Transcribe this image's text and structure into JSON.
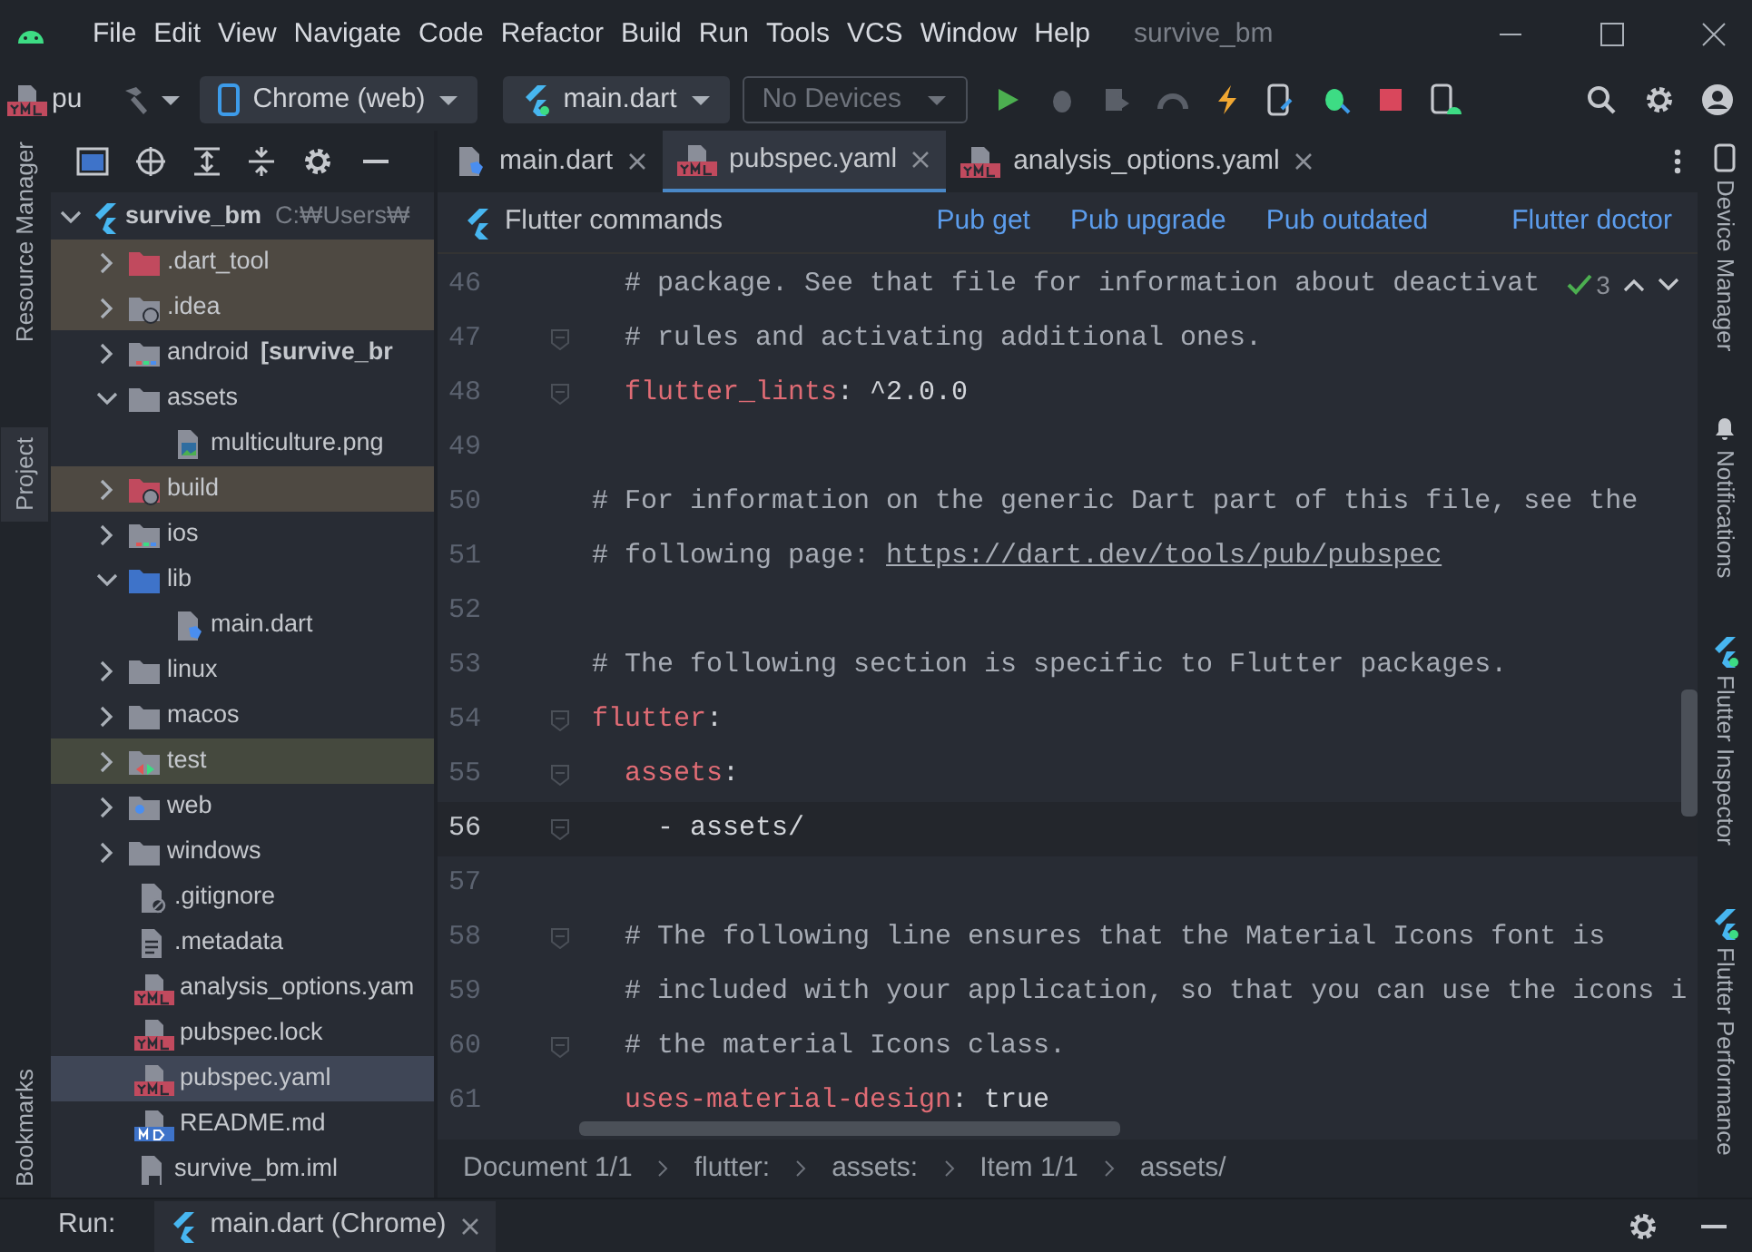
{
  "window": {
    "menu": [
      "File",
      "Edit",
      "View",
      "Navigate",
      "Code",
      "Refactor",
      "Build",
      "Run",
      "Tools",
      "VCS",
      "Window",
      "Help"
    ],
    "title": "survive_bm"
  },
  "toolbar": {
    "project_label": "pu",
    "device": "Chrome (web)",
    "config": "main.dart",
    "devices_placeholder": "No Devices"
  },
  "left_strip": [
    {
      "label": "Resource Manager",
      "selected": false
    },
    {
      "label": "Project",
      "selected": true
    },
    {
      "label": "Bookmarks",
      "selected": false
    }
  ],
  "right_strip": [
    {
      "label": "Device Manager"
    },
    {
      "label": "Notifications"
    },
    {
      "label": "Flutter Inspector"
    },
    {
      "label": "Flutter Performance"
    }
  ],
  "project_tree": [
    {
      "name": "survive_bm",
      "kind": "flutter",
      "path": "C:₩Users₩",
      "expanded": true,
      "selected": false,
      "children": [
        {
          "name": ".dart_tool",
          "kind": "folder-excluded",
          "expanded": false,
          "selected": false,
          "color": "#4e4942"
        },
        {
          "name": ".idea",
          "kind": "folder-settings",
          "expanded": false,
          "selected": false,
          "color": "#4e4942"
        },
        {
          "name": "android",
          "kind": "folder-module",
          "module": "[survive_br",
          "expanded": false,
          "selected": false
        },
        {
          "name": "assets",
          "kind": "folder",
          "expanded": true,
          "selected": false,
          "children": [
            {
              "name": "multiculture.png",
              "kind": "image",
              "selected": false
            }
          ]
        },
        {
          "name": "build",
          "kind": "folder-build",
          "expanded": false,
          "selected": false,
          "color": "#4e4942"
        },
        {
          "name": "ios",
          "kind": "folder-module",
          "expanded": false,
          "selected": false
        },
        {
          "name": "lib",
          "kind": "folder-source",
          "expanded": true,
          "selected": false,
          "children": [
            {
              "name": "main.dart",
              "kind": "dart",
              "selected": false
            }
          ]
        },
        {
          "name": "linux",
          "kind": "folder",
          "expanded": false,
          "selected": false
        },
        {
          "name": "macos",
          "kind": "folder",
          "expanded": false,
          "selected": false
        },
        {
          "name": "test",
          "kind": "folder-test",
          "expanded": false,
          "selected": false,
          "color": "#45493e"
        },
        {
          "name": "web",
          "kind": "folder-web",
          "expanded": false,
          "selected": false
        },
        {
          "name": "windows",
          "kind": "folder",
          "expanded": false,
          "selected": false
        },
        {
          "name": ".gitignore",
          "kind": "ignore",
          "selected": false
        },
        {
          "name": ".metadata",
          "kind": "text",
          "selected": false
        },
        {
          "name": "analysis_options.yam",
          "kind": "yaml",
          "selected": false
        },
        {
          "name": "pubspec.lock",
          "kind": "yaml",
          "selected": false
        },
        {
          "name": "pubspec.yaml",
          "kind": "yaml",
          "selected": true
        },
        {
          "name": "README.md",
          "kind": "markdown",
          "selected": false
        },
        {
          "name": "survive_bm.iml",
          "kind": "iml",
          "selected": false
        }
      ]
    }
  ],
  "tabs": [
    {
      "label": "main.dart",
      "kind": "dart",
      "selected": false
    },
    {
      "label": "pubspec.yaml",
      "kind": "yaml",
      "selected": true
    },
    {
      "label": "analysis_options.yaml",
      "kind": "yaml",
      "selected": false
    }
  ],
  "flutter_commands": {
    "label": "Flutter commands",
    "links": [
      "Pub get",
      "Pub upgrade",
      "Pub outdated",
      "Flutter doctor"
    ]
  },
  "editor": {
    "inspection_count": "3",
    "lines": [
      {
        "number": "46",
        "fold": false,
        "current": false,
        "parts": [
          {
            "kind": "comment",
            "text": "  # package. See that file for information about deactivat"
          }
        ]
      },
      {
        "number": "47",
        "fold": true,
        "current": false,
        "parts": [
          {
            "kind": "comment",
            "text": "  # rules and activating additional ones."
          }
        ]
      },
      {
        "number": "48",
        "fold": true,
        "current": false,
        "parts": [
          {
            "kind": "key",
            "text": "  flutter_lints"
          },
          {
            "kind": "plain",
            "text": ": ^2.0.0"
          }
        ]
      },
      {
        "number": "49",
        "fold": false,
        "current": false
      },
      {
        "number": "50",
        "fold": false,
        "current": false,
        "parts": [
          {
            "kind": "comment",
            "text": "# For information on the generic Dart part of this file, see the"
          }
        ]
      },
      {
        "number": "51",
        "fold": false,
        "current": false,
        "parts": [
          {
            "kind": "comment",
            "text": "# following page: "
          },
          {
            "kind": "link",
            "text": "https://dart.dev/tools/pub/pubspec"
          }
        ]
      },
      {
        "number": "52",
        "fold": false,
        "current": false
      },
      {
        "number": "53",
        "fold": false,
        "current": false,
        "parts": [
          {
            "kind": "comment",
            "text": "# The following section is specific to Flutter packages."
          }
        ]
      },
      {
        "number": "54",
        "fold": true,
        "current": false,
        "parts": [
          {
            "kind": "key",
            "text": "flutter"
          },
          {
            "kind": "plain",
            "text": ":"
          }
        ]
      },
      {
        "number": "55",
        "fold": true,
        "current": false,
        "parts": [
          {
            "kind": "key",
            "text": "  assets"
          },
          {
            "kind": "plain",
            "text": ":"
          }
        ]
      },
      {
        "number": "56",
        "fold": true,
        "current": true,
        "parts": [
          {
            "kind": "plain",
            "text": "    - assets/"
          }
        ]
      },
      {
        "number": "57",
        "fold": false,
        "current": false
      },
      {
        "number": "58",
        "fold": true,
        "current": false,
        "parts": [
          {
            "kind": "comment",
            "text": "  # The following line ensures that the Material Icons font is"
          }
        ]
      },
      {
        "number": "59",
        "fold": false,
        "current": false,
        "parts": [
          {
            "kind": "comment",
            "text": "  # included with your application, so that you can use the icons i"
          }
        ]
      },
      {
        "number": "60",
        "fold": true,
        "current": false,
        "parts": [
          {
            "kind": "comment",
            "text": "  # the material Icons class."
          }
        ]
      },
      {
        "number": "61",
        "fold": false,
        "current": false,
        "parts": [
          {
            "kind": "key",
            "text": "  uses-material-design"
          },
          {
            "kind": "plain",
            "text": ": true"
          }
        ]
      }
    ]
  },
  "breadcrumbs": [
    "Document 1/1",
    "flutter:",
    "assets:",
    "Item 1/1",
    "assets/"
  ],
  "run_bar": {
    "label": "Run:",
    "tab": "main.dart (Chrome)"
  }
}
